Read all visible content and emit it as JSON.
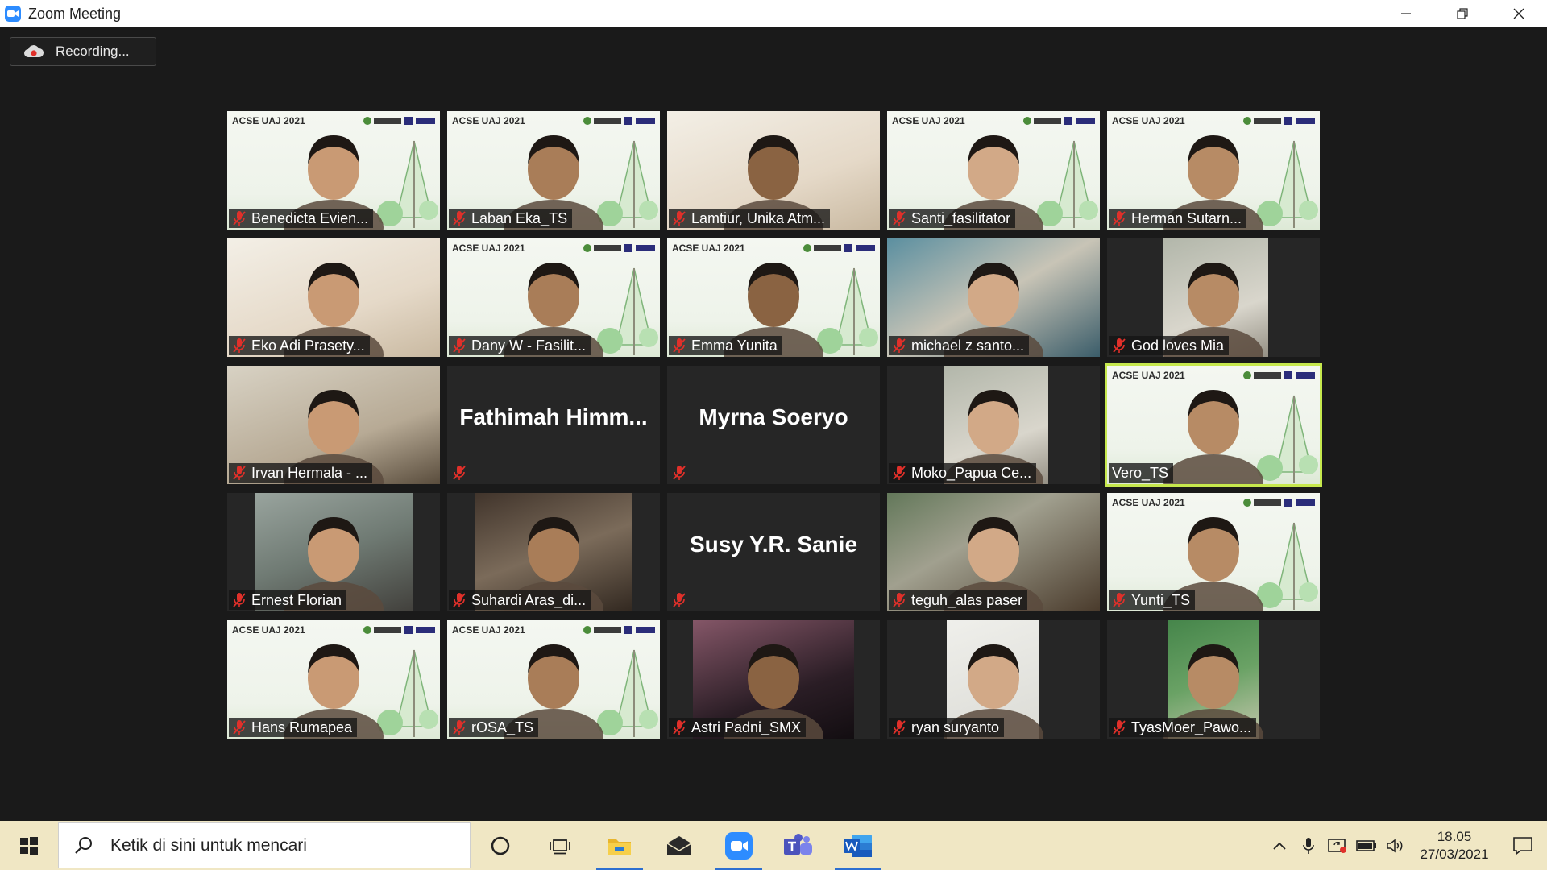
{
  "window": {
    "title": "Zoom Meeting"
  },
  "recording": {
    "label": "Recording..."
  },
  "tile_watermark": "ACSE UAJ 2021",
  "participants": [
    {
      "name": "Benedicta Evien...",
      "bg": "cam-ts"
    },
    {
      "name": "Laban Eka_TS",
      "bg": "cam-ts"
    },
    {
      "name": "Lamtiur, Unika Atm...",
      "bg": "ph-2"
    },
    {
      "name": "Santi_fasilitator",
      "bg": "cam-ts"
    },
    {
      "name": "Herman Sutarn...",
      "bg": "cam-ts"
    },
    {
      "name": "Eko Adi Prasety...",
      "bg": "ph-2"
    },
    {
      "name": "Dany W - Fasilit...",
      "bg": "cam-ts"
    },
    {
      "name": "Emma Yunita",
      "bg": "cam-ts"
    },
    {
      "name": "michael z santo...",
      "bg": "ph-3"
    },
    {
      "name": "God loves Mia",
      "bg": "ph-4"
    },
    {
      "name": "Irvan Hermala - ...",
      "bg": "ph-6"
    },
    {
      "name": "Fathimah  Himm...",
      "video": false
    },
    {
      "name": "Myrna Soeryo",
      "video": false
    },
    {
      "name": "Moko_Papua Ce...",
      "bg": "ph-4"
    },
    {
      "name": "Vero_TS",
      "bg": "cam-ts",
      "active": true
    },
    {
      "name": "Ernest Florian",
      "bg": "ph-10"
    },
    {
      "name": "Suhardi Aras_di...",
      "bg": "ph-11"
    },
    {
      "name": "Susy Y.R. Sanie",
      "video": false
    },
    {
      "name": "teguh_alas paser",
      "bg": "ph-5"
    },
    {
      "name": "Yunti_TS",
      "bg": "cam-ts"
    },
    {
      "name": "Hans Rumapea",
      "bg": "cam-ts"
    },
    {
      "name": "rOSA_TS",
      "bg": "cam-ts"
    },
    {
      "name": "Astri Padni_SMX",
      "bg": "ph-7"
    },
    {
      "name": "ryan suryanto",
      "bg": "ph-8"
    },
    {
      "name": "TyasMoer_Pawo...",
      "bg": "ph-9"
    }
  ],
  "taskbar": {
    "search_placeholder": "Ketik di sini untuk mencari",
    "clock_time": "18.05",
    "clock_date": "27/03/2021"
  },
  "colors": {
    "meeting_bg": "#1a1a1a",
    "active_speaker": "#c6e84d",
    "mic_muted": "#e0302a",
    "taskbar_bg": "#f0e7c4",
    "zoom_blue": "#2d8cff"
  }
}
